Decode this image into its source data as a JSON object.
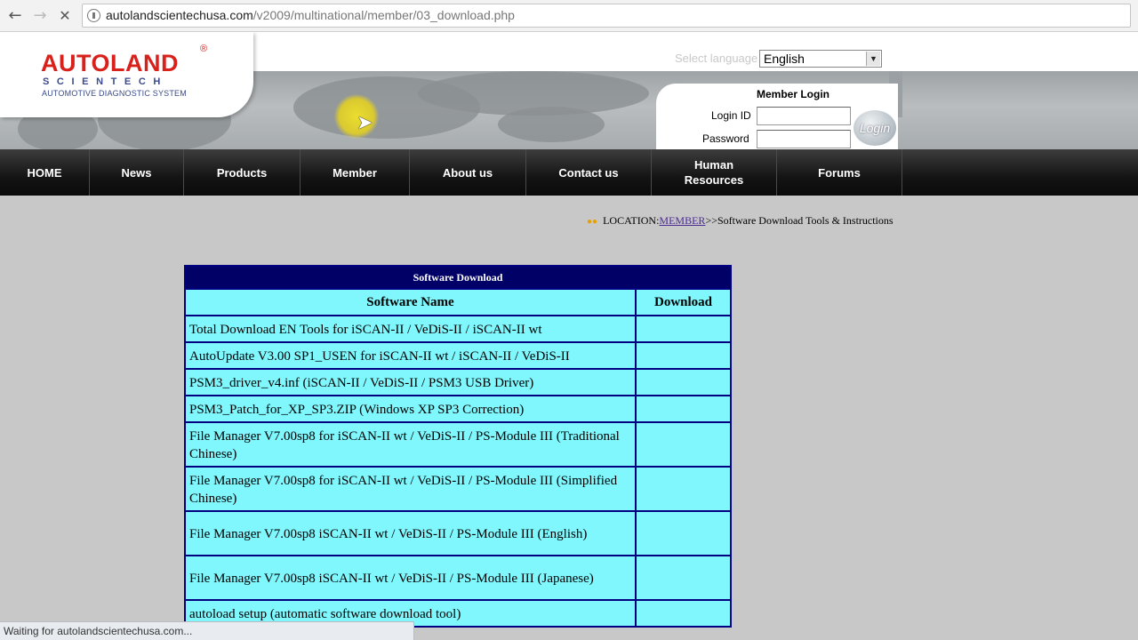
{
  "browser": {
    "url_host": "autolandscientechusa.com",
    "url_path": "/v2009/multinational/member/03_download.php",
    "status": "Waiting for autolandscientechusa.com..."
  },
  "logo": {
    "main": "AUTOLAND",
    "reg": "®",
    "sub": "SCIENTECH",
    "tagline": "AUTOMOTIVE DIAGNOSTIC SYSTEM"
  },
  "language": {
    "label": "Select language",
    "selected": "English"
  },
  "login": {
    "title": "Member Login",
    "id_label": "Login ID",
    "password_label": "Password",
    "button": "Login"
  },
  "nav": [
    {
      "label": "HOME"
    },
    {
      "label": "News"
    },
    {
      "label": "Products"
    },
    {
      "label": "Member"
    },
    {
      "label": "About us"
    },
    {
      "label": "Contact us"
    },
    {
      "label": "Human Resources"
    },
    {
      "label": "Forums"
    }
  ],
  "location": {
    "prefix": "LOCATION:",
    "link": "MEMBER",
    "rest": ">>Software Download Tools & Instructions"
  },
  "table": {
    "title": "Software Download",
    "col_name": "Software Name",
    "col_download": "Download",
    "rows": [
      "Total Download EN Tools for iSCAN-II / VeDiS-II / iSCAN-II wt",
      "AutoUpdate V3.00 SP1_USEN for iSCAN-II wt / iSCAN-II / VeDiS-II",
      "PSM3_driver_v4.inf (iSCAN-II / VeDiS-II / PSM3 USB Driver)",
      "PSM3_Patch_for_XP_SP3.ZIP (Windows XP SP3 Correction)",
      "File Manager V7.00sp8 for iSCAN-II wt / VeDiS-II / PS-Module III (Traditional Chinese)",
      "File Manager V7.00sp8 for iSCAN-II wt / VeDiS-II / PS-Module III (Simplified Chinese)",
      "File Manager V7.00sp8 iSCAN-II wt / VeDiS-II / PS-Module III (English)",
      "File Manager V7.00sp8 iSCAN-II wt / VeDiS-II / PS-Module III (Japanese)",
      "autoload setup (automatic software download tool)"
    ]
  },
  "colors": {
    "brand_red": "#d9211c",
    "table_header_bg": "#000066",
    "table_cell_bg": "#7ff7fd",
    "nav_bg": "#141414"
  }
}
